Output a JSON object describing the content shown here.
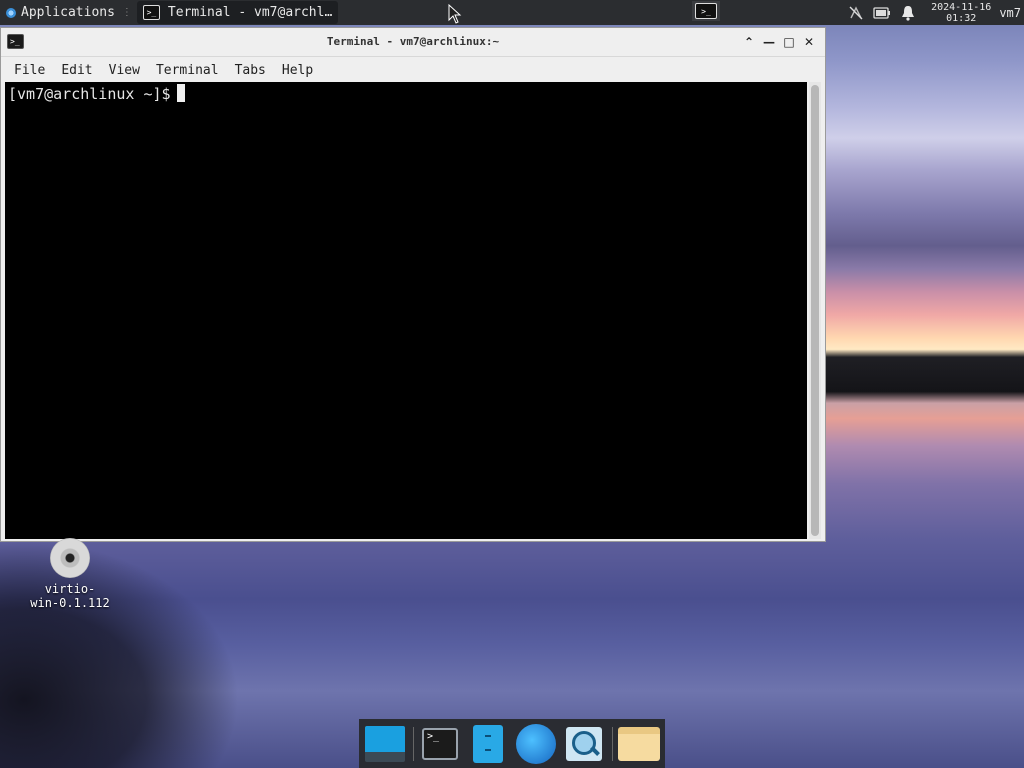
{
  "top_panel": {
    "applications_label": "Applications",
    "separator": "⋮",
    "task_label": "Terminal - vm7@archl…",
    "clock_date": "2024-11-16",
    "clock_time": "01:32",
    "user": "vm7"
  },
  "window": {
    "title": "Terminal - vm7@archlinux:~",
    "icon_glyph": ">_",
    "controls": {
      "shade": "⌃",
      "minimize": "—",
      "maximize": "□",
      "close": "✕"
    },
    "menu": {
      "file": "File",
      "edit": "Edit",
      "view": "View",
      "terminal": "Terminal",
      "tabs": "Tabs",
      "help": "Help"
    },
    "prompt": "[vm7@archlinux ~]$"
  },
  "desktop": {
    "icon_label_line1": "virtio-",
    "icon_label_line2": "win-0.1.112"
  },
  "dock": {
    "items": [
      "show-desktop",
      "terminal",
      "file-manager",
      "web-browser",
      "app-finder",
      "home-folder"
    ]
  },
  "colors": {
    "panel_bg": "#2b2d30",
    "terminal_bg": "#000000",
    "window_bg": "#efefef",
    "accent_blue": "#1aa0e0"
  }
}
